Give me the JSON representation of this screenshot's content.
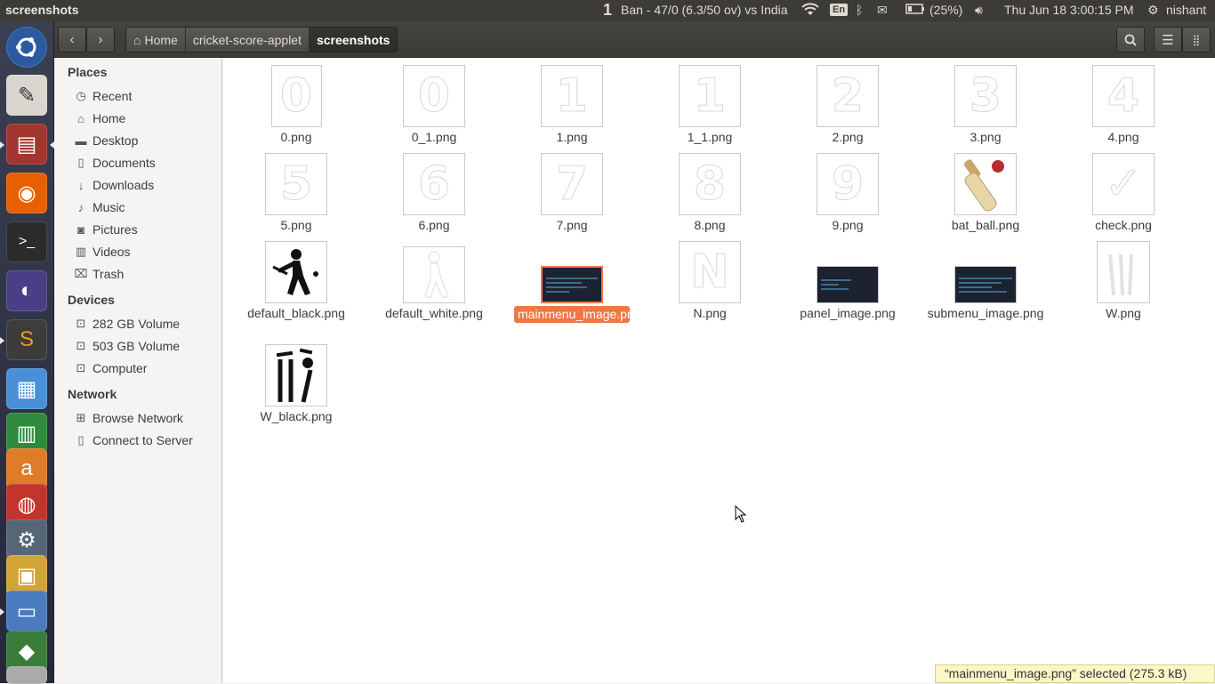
{
  "window_title": "screenshots",
  "panel": {
    "workspace": "1",
    "cricket_score": "Ban - 47/0 (6.3/50 ov) vs India",
    "keyboard": "En",
    "battery": "(25%)",
    "datetime": "Thu Jun 18  3:00:15 PM",
    "user": "nishant"
  },
  "toolbar": {
    "back_icon": "chevron-left-icon",
    "forward_icon": "chevron-right-icon",
    "crumbs": [
      "Home",
      "cricket-score-applet",
      "screenshots"
    ],
    "search_icon": "search-icon",
    "menu_icon": "hamburger-menu-icon",
    "grid_icon": "grid-view-icon"
  },
  "sidebar": {
    "places_heading": "Places",
    "places": [
      "Recent",
      "Home",
      "Desktop",
      "Documents",
      "Downloads",
      "Music",
      "Pictures",
      "Videos",
      "Trash"
    ],
    "devices_heading": "Devices",
    "devices": [
      "282 GB Volume",
      "503 GB Volume",
      "Computer"
    ],
    "network_heading": "Network",
    "network": [
      "Browse Network",
      "Connect to Server"
    ]
  },
  "files": [
    {
      "name": "0.png",
      "glyph": "0"
    },
    {
      "name": "0_1.png",
      "glyph": "0"
    },
    {
      "name": "1.png",
      "glyph": "1"
    },
    {
      "name": "1_1.png",
      "glyph": "1"
    },
    {
      "name": "2.png",
      "glyph": "2"
    },
    {
      "name": "3.png",
      "glyph": "3"
    },
    {
      "name": "4.png",
      "glyph": "4"
    },
    {
      "name": "5.png",
      "glyph": "5"
    },
    {
      "name": "6.png",
      "glyph": "6"
    },
    {
      "name": "7.png",
      "glyph": "7"
    },
    {
      "name": "8.png",
      "glyph": "8"
    },
    {
      "name": "9.png",
      "glyph": "9"
    },
    {
      "name": "bat_ball.png",
      "glyph": ""
    },
    {
      "name": "check.png",
      "glyph": "✓"
    },
    {
      "name": "default_black.png",
      "glyph": ""
    },
    {
      "name": "default_white.png",
      "glyph": ""
    },
    {
      "name": "mainmenu_image.png",
      "glyph": ""
    },
    {
      "name": "N.png",
      "glyph": "N"
    },
    {
      "name": "panel_image.png",
      "glyph": ""
    },
    {
      "name": "submenu_image.png",
      "glyph": ""
    },
    {
      "name": "W.png",
      "glyph": ""
    },
    {
      "name": "W_black.png",
      "glyph": ""
    }
  ],
  "status": "“mainmenu_image.png” selected  (275.3 kB)",
  "colors": {
    "selection": "#f07746",
    "panel": "#3c3b37"
  }
}
